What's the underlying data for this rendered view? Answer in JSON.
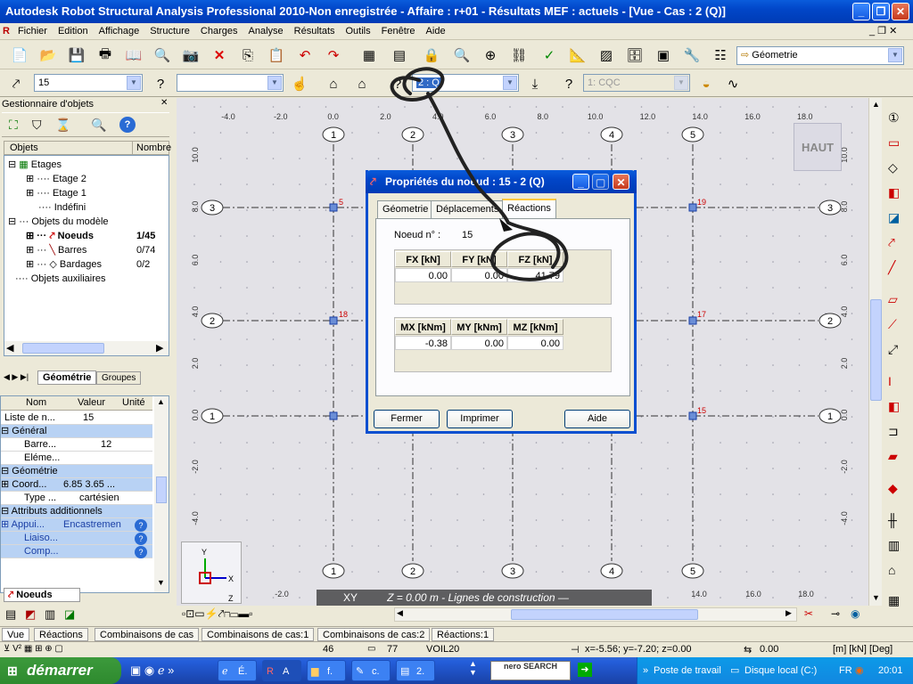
{
  "window": {
    "title": "Autodesk Robot Structural Analysis Professional 2010-Non enregistrée - Affaire : r+01 - Résultats MEF : actuels - [Vue - Cas : 2 (Q)]"
  },
  "menubar": {
    "items": [
      "Fichier",
      "Edition",
      "Affichage",
      "Structure",
      "Charges",
      "Analyse",
      "Résultats",
      "Outils",
      "Fenêtre",
      "Aide"
    ]
  },
  "toolbar": {
    "view_combo": "Géometrie",
    "node_combo": "15",
    "case_combo": "2 : Q",
    "mode_combo": "1: CQC"
  },
  "left_panel": {
    "title": "Gestionnaire d'objets",
    "col_objects": "Objets",
    "col_number": "Nombre",
    "tree": [
      {
        "label": "Etages",
        "count": ""
      },
      {
        "label": "Etage 2",
        "count": ""
      },
      {
        "label": "Etage 1",
        "count": ""
      },
      {
        "label": "Indéfini",
        "count": ""
      },
      {
        "label": "Objets du modèle",
        "count": ""
      },
      {
        "label": "Noeuds",
        "count": "1/45"
      },
      {
        "label": "Barres",
        "count": "0/74"
      },
      {
        "label": "Bardages",
        "count": "0/2"
      },
      {
        "label": "Objets auxiliaires",
        "count": ""
      }
    ],
    "tab_geometry": "Géométrie",
    "tab_groups": "Groupes",
    "prop_headers": {
      "name": "Nom",
      "value": "Valeur",
      "unit": "Unité"
    },
    "props": [
      {
        "name": "Liste de n...",
        "value": "15",
        "section": false
      },
      {
        "name": "Général",
        "value": "",
        "section": true
      },
      {
        "name": "Barre...",
        "value": "12",
        "section": false
      },
      {
        "name": "Eléme...",
        "value": "",
        "section": false
      },
      {
        "name": "Géométrie",
        "value": "",
        "section": true
      },
      {
        "name": "Coord...",
        "value": "6.85 3.65 ...",
        "section": false
      },
      {
        "name": "Type ...",
        "value": "cartésien",
        "section": false
      },
      {
        "name": "Attributs additionnels",
        "value": "",
        "section": true
      },
      {
        "name": "Appui...",
        "value": "Encastremen",
        "section": false
      },
      {
        "name": "Liaiso...",
        "value": "",
        "section": false
      },
      {
        "name": "Comp...",
        "value": "",
        "section": false
      }
    ],
    "bottom_tab": "Noeuds"
  },
  "canvas": {
    "haut_label": "HAUT",
    "x_ticks": [
      "-4.0",
      "-2.0",
      "0.0",
      "2.0",
      "4.0",
      "6.0",
      "8.0",
      "10.0",
      "12.0",
      "14.0",
      "16.0",
      "18.0"
    ],
    "y_ticks": [
      "10.0",
      "8.0",
      "6.0",
      "4.0",
      "2.0",
      "0.0",
      "-2.0",
      "-4.0"
    ],
    "col_markers": [
      "1",
      "2",
      "3",
      "4",
      "5"
    ],
    "row_markers": [
      "3",
      "2",
      "1"
    ],
    "node_labels": [
      "5",
      "19",
      "18",
      "17",
      "15"
    ],
    "overlay_text_xy": "XY",
    "overlay_text": "Z = 0.00 m - Lignes de construction —",
    "bottom_ticks": [
      "-2.0",
      "14.0",
      "16.0",
      "18.0"
    ]
  },
  "dialog": {
    "title": "Propriétés du noeud : 15 - 2 (Q)",
    "tabs": [
      "Géometrie",
      "Déplacements",
      "Réactions"
    ],
    "node_label": "Noeud n° :",
    "node_value": "15",
    "forces_headers": [
      "FX [kN]",
      "FY [kN]",
      "FZ [kN]"
    ],
    "forces_values": [
      "0.00",
      "0.00",
      "41.79"
    ],
    "moments_headers": [
      "MX [kNm]",
      "MY [kNm]",
      "MZ [kNm]"
    ],
    "moments_values": [
      "-0.38",
      "0.00",
      "0.00"
    ],
    "btn_close": "Fermer",
    "btn_print": "Imprimer",
    "btn_help": "Aide"
  },
  "bottom_tabs": [
    "Vue",
    "Réactions",
    "Combinaisons de cas",
    "Combinaisons de cas:1",
    "Combinaisons de cas:2",
    "Réactions:1"
  ],
  "statusbar": {
    "count1": "46",
    "count2": "77",
    "section": "VOIL20",
    "coords": "x=-5.56; y=-7.20; z=0.00",
    "angle": "0.00",
    "units": "[m] [kN] [Deg]"
  },
  "taskbar": {
    "start": "démarrer",
    "tasks": [
      "É.",
      "A",
      "f.",
      "c.",
      "2."
    ],
    "search": "nero SEARCH",
    "tray_workstation": "Poste de travail",
    "tray_disk": "Disque local (C:)",
    "lang": "FR",
    "clock": "20:01"
  },
  "colors": {
    "titlebar": "#0146c8",
    "canvas_bg": "#e3e2e7",
    "section_bg": "#b8d2f4",
    "accent": "#ffc83c"
  }
}
